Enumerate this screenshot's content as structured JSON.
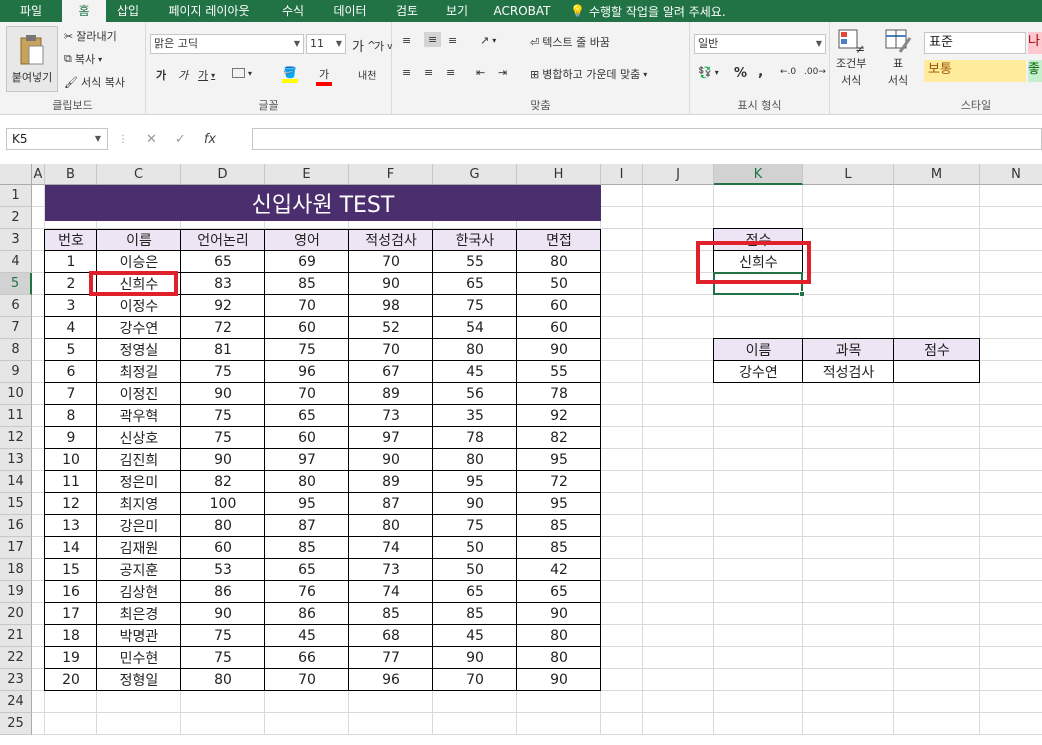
{
  "tabs": [
    "파일",
    "홈",
    "삽입",
    "페이지 레이아웃",
    "수식",
    "데이터",
    "검토",
    "보기",
    "ACROBAT"
  ],
  "active_tab": "홈",
  "tell_me": "수행할 작업을 알려 주세요.",
  "ribbon": {
    "clipboard": {
      "paste": "붙여넣기",
      "cut": "잘라내기",
      "copy": "복사",
      "format_painter": "서식 복사",
      "label": "클립보드"
    },
    "font": {
      "name": "맑은 고딕",
      "size": "11",
      "grow": "가",
      "shrink": "가",
      "bold": "가",
      "italic": "가",
      "underline": "가",
      "color_letter": "가",
      "phonetic": "내천",
      "label": "글꼴"
    },
    "alignment": {
      "wrap": "텍스트 줄 바꿈",
      "merge": "병합하고 가운데 맞춤",
      "label": "맞춤"
    },
    "number": {
      "format": "일반",
      "percent": "%",
      "comma": ",",
      "label": "표시 형식"
    },
    "styles": {
      "conditional": "조건부",
      "conditional2": "서식",
      "table": "표",
      "table2": "서식",
      "normal": "표준",
      "good": "보통",
      "bad": "나",
      "neutral": "좋",
      "label": "스타일"
    }
  },
  "formula_bar": {
    "name_box": "K5",
    "fx": "fx",
    "value": ""
  },
  "columns": [
    "A",
    "B",
    "C",
    "D",
    "E",
    "F",
    "G",
    "H",
    "I",
    "J",
    "K",
    "L",
    "M",
    "N"
  ],
  "rows": [
    "1",
    "2",
    "3",
    "4",
    "5",
    "6",
    "7",
    "8",
    "9",
    "10",
    "11",
    "12",
    "13",
    "14",
    "15",
    "16",
    "17",
    "18",
    "19",
    "20",
    "21",
    "22",
    "23",
    "24",
    "25"
  ],
  "sheet": {
    "title": "신입사원 TEST",
    "headers": [
      "번호",
      "이름",
      "언어논리",
      "영어",
      "적성검사",
      "한국사",
      "면접"
    ],
    "rows": [
      [
        "1",
        "이승은",
        "65",
        "69",
        "70",
        "55",
        "80"
      ],
      [
        "2",
        "신희수",
        "83",
        "85",
        "90",
        "65",
        "50"
      ],
      [
        "3",
        "이정수",
        "92",
        "70",
        "98",
        "75",
        "60"
      ],
      [
        "4",
        "강수연",
        "72",
        "60",
        "52",
        "54",
        "60"
      ],
      [
        "5",
        "정영실",
        "81",
        "75",
        "70",
        "80",
        "90"
      ],
      [
        "6",
        "최정길",
        "75",
        "96",
        "67",
        "45",
        "55"
      ],
      [
        "7",
        "이정진",
        "90",
        "70",
        "89",
        "56",
        "78"
      ],
      [
        "8",
        "곽우혁",
        "75",
        "65",
        "73",
        "35",
        "92"
      ],
      [
        "9",
        "신상호",
        "75",
        "60",
        "97",
        "78",
        "82"
      ],
      [
        "10",
        "김진희",
        "90",
        "97",
        "90",
        "80",
        "95"
      ],
      [
        "11",
        "정은미",
        "82",
        "80",
        "89",
        "95",
        "72"
      ],
      [
        "12",
        "최지영",
        "100",
        "95",
        "87",
        "90",
        "95"
      ],
      [
        "13",
        "강은미",
        "80",
        "87",
        "80",
        "75",
        "85"
      ],
      [
        "14",
        "김재원",
        "60",
        "85",
        "74",
        "50",
        "85"
      ],
      [
        "15",
        "공지훈",
        "53",
        "65",
        "73",
        "50",
        "42"
      ],
      [
        "16",
        "김상현",
        "86",
        "76",
        "74",
        "65",
        "65"
      ],
      [
        "17",
        "최은경",
        "90",
        "86",
        "85",
        "85",
        "90"
      ],
      [
        "18",
        "박명관",
        "75",
        "45",
        "68",
        "45",
        "80"
      ],
      [
        "19",
        "민수현",
        "75",
        "66",
        "77",
        "90",
        "80"
      ],
      [
        "20",
        "정형일",
        "80",
        "70",
        "96",
        "70",
        "90"
      ]
    ],
    "score_header": "점수",
    "score_value": "신희수",
    "lookup_headers": [
      "이름",
      "과목",
      "점수"
    ],
    "lookup_values": [
      "강수연",
      "적성검사",
      ""
    ]
  }
}
